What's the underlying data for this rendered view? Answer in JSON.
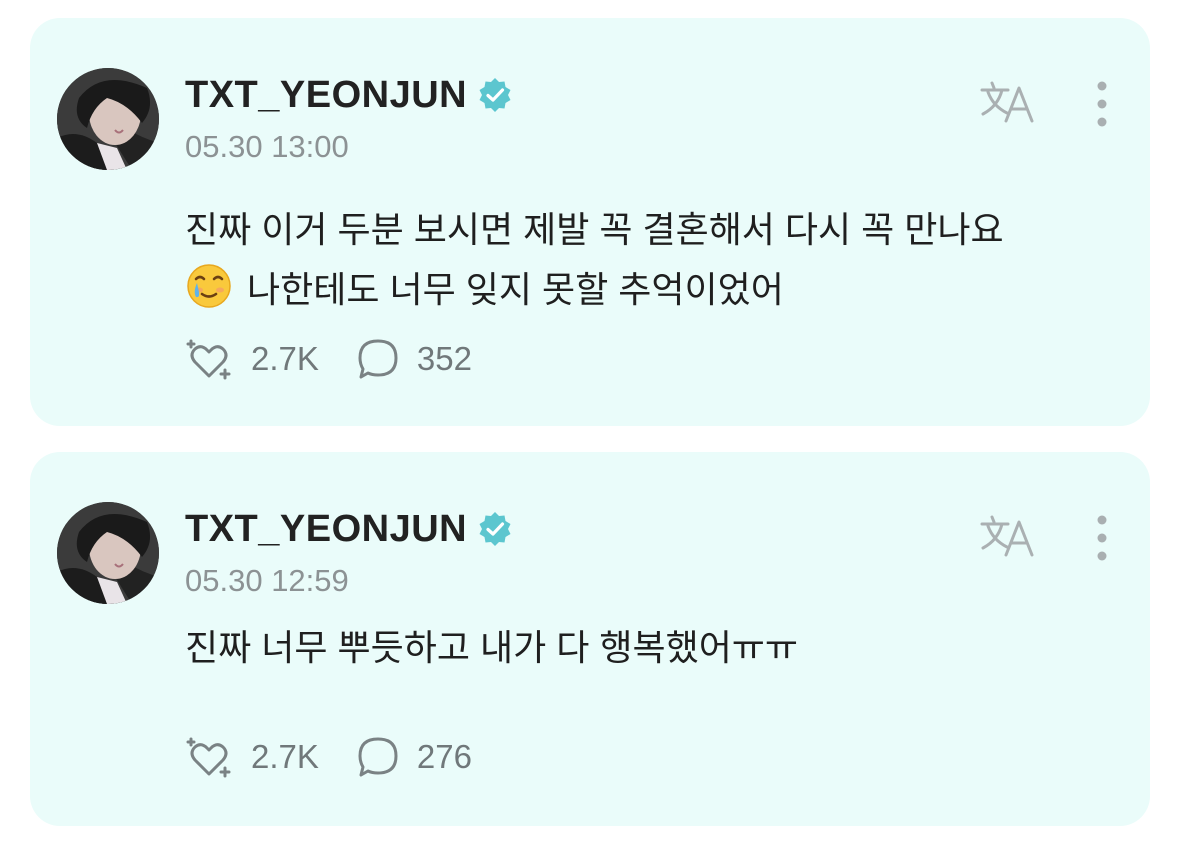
{
  "colors": {
    "card_background": "#eafcfa",
    "verified_badge": "#5cc6cf",
    "text_primary": "#222222",
    "text_muted": "#8c9294"
  },
  "posts": [
    {
      "username": "TXT_YEONJUN",
      "verified": true,
      "timestamp": "05.30 13:00",
      "text_line_1": "진짜 이거 두분 보시면 제발 꼭 결혼해서 다시 꼭 만나요",
      "text_line_2": "나한테도 너무 잊지 못할 추억이었어",
      "inline_emoji": "smiling-face-with-tear-icon",
      "likes": "2.7K",
      "comments": "352"
    },
    {
      "username": "TXT_YEONJUN",
      "verified": true,
      "timestamp": "05.30 12:59",
      "text_line_1": "진짜 너무 뿌듯하고 내가 다 행복했어ㅠㅠ",
      "likes": "2.7K",
      "comments": "276"
    }
  ]
}
